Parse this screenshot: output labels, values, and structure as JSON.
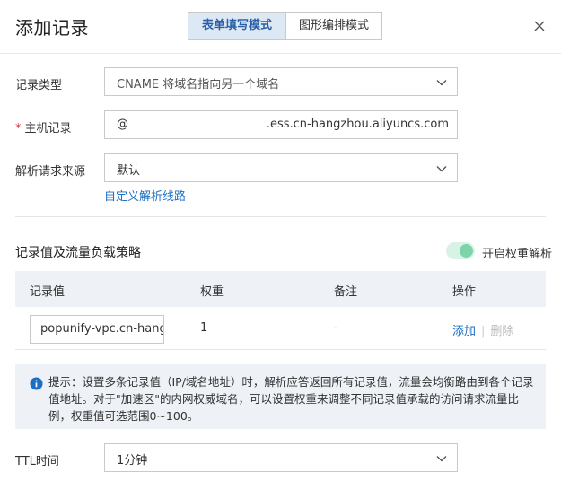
{
  "dialog": {
    "title": "添加记录",
    "modes": [
      {
        "label": "表单填写模式",
        "active": true
      },
      {
        "label": "图形编排模式",
        "active": false
      }
    ],
    "close_icon": "close-icon"
  },
  "form": {
    "record_type": {
      "label": "记录类型",
      "value": "CNAME 将域名指向另一个域名"
    },
    "host_record": {
      "label": "主机记录",
      "required_mark": "*",
      "value": "@",
      "suffix": ".ess.cn-hangzhou.aliyuncs.com"
    },
    "resolve_source": {
      "label": "解析请求来源",
      "value": "默认",
      "custom_link": "自定义解析线路"
    },
    "ttl": {
      "label": "TTL时间",
      "value": "1分钟"
    }
  },
  "records": {
    "section_title": "记录值及流量负载策略",
    "weight_toggle": {
      "label": "开启权重解析",
      "enabled": true
    },
    "columns": [
      "记录值",
      "权重",
      "备注",
      "操作"
    ],
    "rows": [
      {
        "value": "popunify-vpc.cn-hangzhou",
        "weight": "1",
        "remark": "-",
        "actions": {
          "add": "添加",
          "delete": "删除"
        }
      }
    ]
  },
  "notice": {
    "icon": "info-icon",
    "text": "提示：设置多条记录值（IP/域名地址）时，解析应答返回所有记录值，流量会均衡路由到各个记录值地址。对于\"加速区\"的内网权威域名，可以设置权重来调整不同记录值承载的访问请求流量比例，权重值可选范围0~100。"
  },
  "colors": {
    "accent": "#1a6fc4",
    "active_tab_bg": "#dde8f5",
    "toggle_on": "#7ed4a8",
    "required": "#d9363e"
  }
}
